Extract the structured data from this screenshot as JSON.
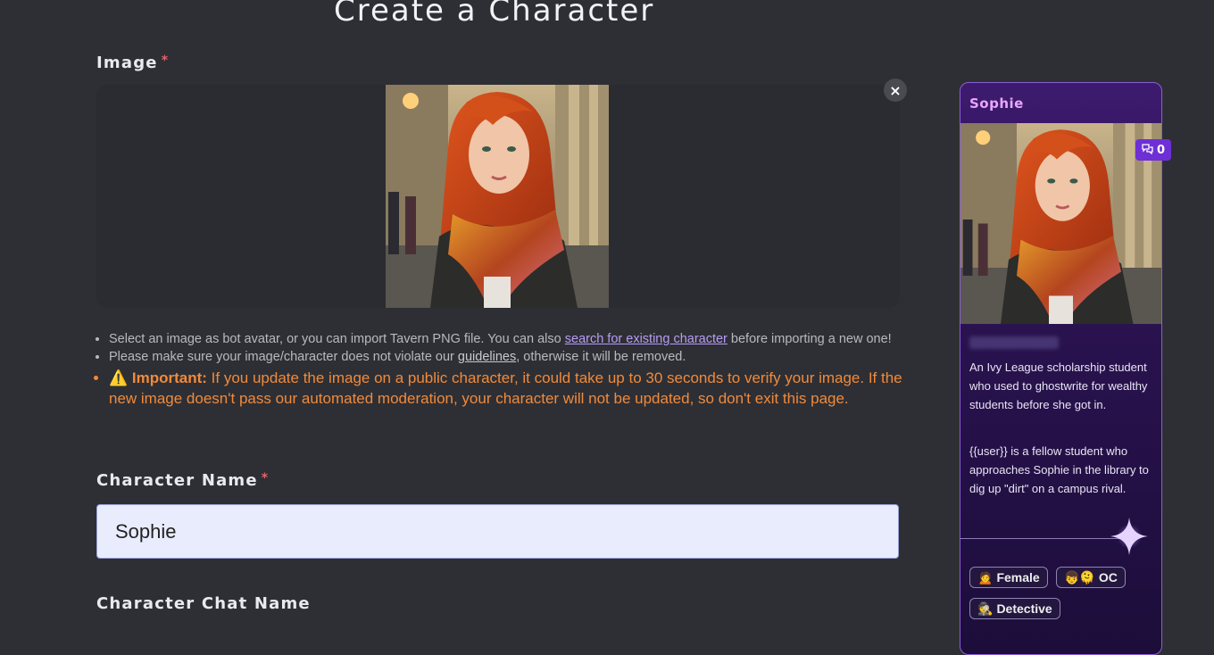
{
  "page": {
    "title": "Create a Character"
  },
  "image_field": {
    "label": "Image",
    "required_mark": "*",
    "remove_label": "×"
  },
  "notes": {
    "item1_pre": "Select an image as bot avatar, or you can import Tavern PNG file. You can also ",
    "item1_link": "search for existing character",
    "item1_post": " before importing a new one!",
    "item2_pre": "Please make sure your image/character does not violate our ",
    "item2_link": "guidelines",
    "item2_post": ", otherwise it will be removed.",
    "important_icon": "⚠️",
    "important_label": "Important:",
    "important_text": " If you update the image on a public character, it could take up to 30 seconds to verify your image. If the new image doesn't pass our automated moderation, your character will not be updated, so don't exit this page."
  },
  "character_name": {
    "label": "Character Name",
    "required_mark": "*",
    "value": "Sophie"
  },
  "chat_name": {
    "label": "Character Chat Name"
  },
  "preview": {
    "name": "Sophie",
    "chat_count": "0",
    "description1": "An Ivy League scholarship student who used to ghostwrite for wealthy students before she got in.",
    "description2": "{{user}} is a fellow student who approaches Sophie in the library to dig up \"dirt\" on a campus rival.",
    "tags": [
      {
        "emoji": "🙍",
        "label": "Female"
      },
      {
        "emoji": "👦🫠",
        "label": "OC"
      },
      {
        "emoji": "🕵️",
        "label": "Detective"
      }
    ]
  },
  "colors": {
    "background": "#2e2f34",
    "accent_purple": "#8a5fd6",
    "warning_orange": "#f08a3c",
    "input_bg": "#e8ecfd"
  },
  "icons": {
    "remove": "close-icon",
    "chat": "chat-bubbles-icon",
    "warning": "warning-icon",
    "sparkle": "sparkle-icon"
  }
}
